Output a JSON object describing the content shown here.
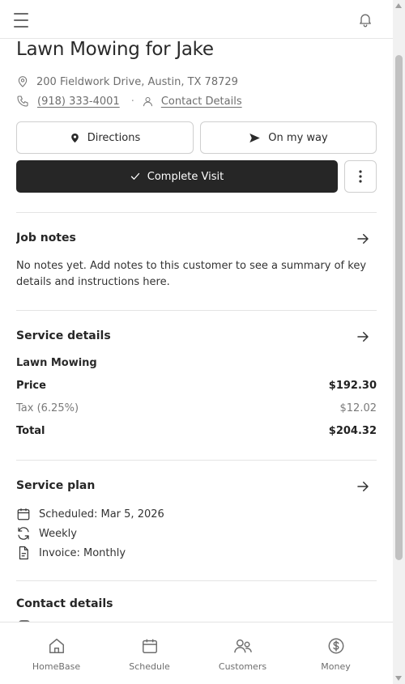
{
  "job": {
    "title": "Lawn Mowing for Jake",
    "address": "200 Fieldwork Drive, Austin, TX 78729",
    "phone": "(918) 333-4001",
    "contact_link": "Contact Details"
  },
  "actions": {
    "directions": "Directions",
    "on_my_way": "On my way",
    "complete": "Complete Visit"
  },
  "job_notes": {
    "title": "Job notes",
    "body": "No notes yet. Add notes to this customer to see a summary of key details and instructions here."
  },
  "service_details": {
    "title": "Service details",
    "service_name": "Lawn Mowing",
    "price_label": "Price",
    "price_value": "$192.30",
    "tax_label": "Tax (6.25%)",
    "tax_value": "$12.02",
    "total_label": "Total",
    "total_value": "$204.32"
  },
  "service_plan": {
    "title": "Service plan",
    "scheduled": "Scheduled: Mar 5, 2026",
    "frequency": "Weekly",
    "invoice": "Invoice: Monthly"
  },
  "contact_details": {
    "title": "Contact details"
  },
  "nav": {
    "items": [
      {
        "label": "HomeBase",
        "icon": "home-icon"
      },
      {
        "label": "Schedule",
        "icon": "calendar-icon"
      },
      {
        "label": "Customers",
        "icon": "users-icon"
      },
      {
        "label": "Money",
        "icon": "dollar-icon"
      }
    ]
  },
  "colors": {
    "primary_button": "#262626",
    "text": "#222222",
    "muted": "#6e6e6e",
    "divider": "#e4e4e4"
  }
}
